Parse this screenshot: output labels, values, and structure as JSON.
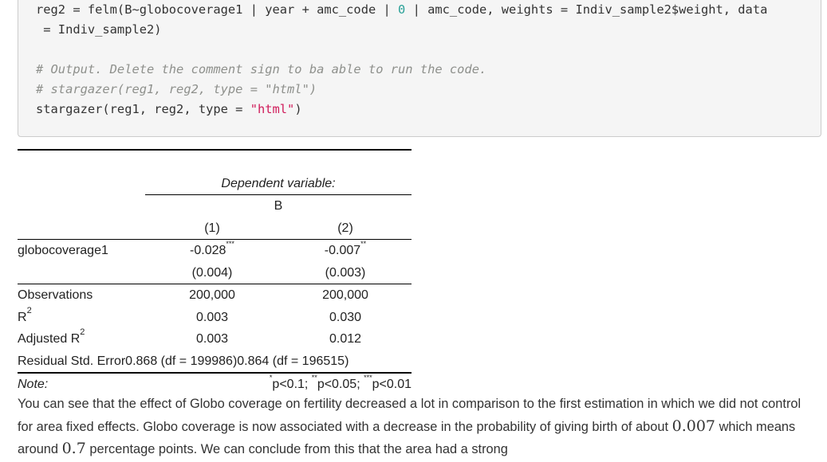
{
  "code_block": {
    "lines": [
      {
        "parts": [
          "reg2 = felm(B~globocoverage1 | year + amc_code | ",
          "0",
          " | amc_code, weights = Indiv_sample2$weight, data"
        ]
      },
      {
        "text": " = Indiv_sample2)"
      },
      {
        "text": ""
      },
      {
        "comment": "# Output. Delete the comment sign to ba able to run the code."
      },
      {
        "comment": "# stargazer(reg1, reg2, type = \"html\")"
      },
      {
        "parts": [
          "stargazer(reg1, reg2, type = ",
          "\"html\"",
          ")"
        ]
      }
    ],
    "colors": {
      "comment": "#8e908c",
      "number": "#2aa198",
      "string": "#d01c5a"
    }
  },
  "regression_table": {
    "dependent_variable_label": "Dependent variable:",
    "dependent_variable": "B",
    "columns": [
      "(1)",
      "(2)"
    ],
    "rows": [
      {
        "label": "globocoverage1",
        "values": [
          "-0.028",
          "-0.007"
        ],
        "stars": [
          "***",
          "**"
        ]
      },
      {
        "label": "",
        "values": [
          "(0.004)",
          "(0.003)"
        ]
      }
    ],
    "stats": [
      {
        "label": "Observations",
        "values": [
          "200,000",
          "200,000"
        ]
      },
      {
        "label": "R",
        "sup": "2",
        "values": [
          "0.003",
          "0.030"
        ]
      },
      {
        "label": "Adjusted R",
        "sup": "2",
        "values": [
          "0.003",
          "0.012"
        ]
      }
    ],
    "residual": {
      "label": "Residual Std. Error",
      "col1": "0.868 (df = 199986)",
      "col2": "0.864 (df = 196515)"
    },
    "note": {
      "label": "Note:",
      "items": [
        {
          "stars": "*",
          "text": "p<0.1; "
        },
        {
          "stars": "**",
          "text": "p<0.05; "
        },
        {
          "stars": "***",
          "text": "p<0.01"
        }
      ]
    }
  },
  "paragraph": {
    "part1": "You can see that the effect of Globo coverage on fertility decreased a lot in comparison to the first estimation in which we did not control for area fixed effects. Globo coverage is now associated with a decrease in the probability of giving birth of about ",
    "math1": "0.007",
    "part2": " which means around ",
    "math2": "0.7",
    "part3": " percentage points. We can conclude from this that the area had a strong"
  }
}
